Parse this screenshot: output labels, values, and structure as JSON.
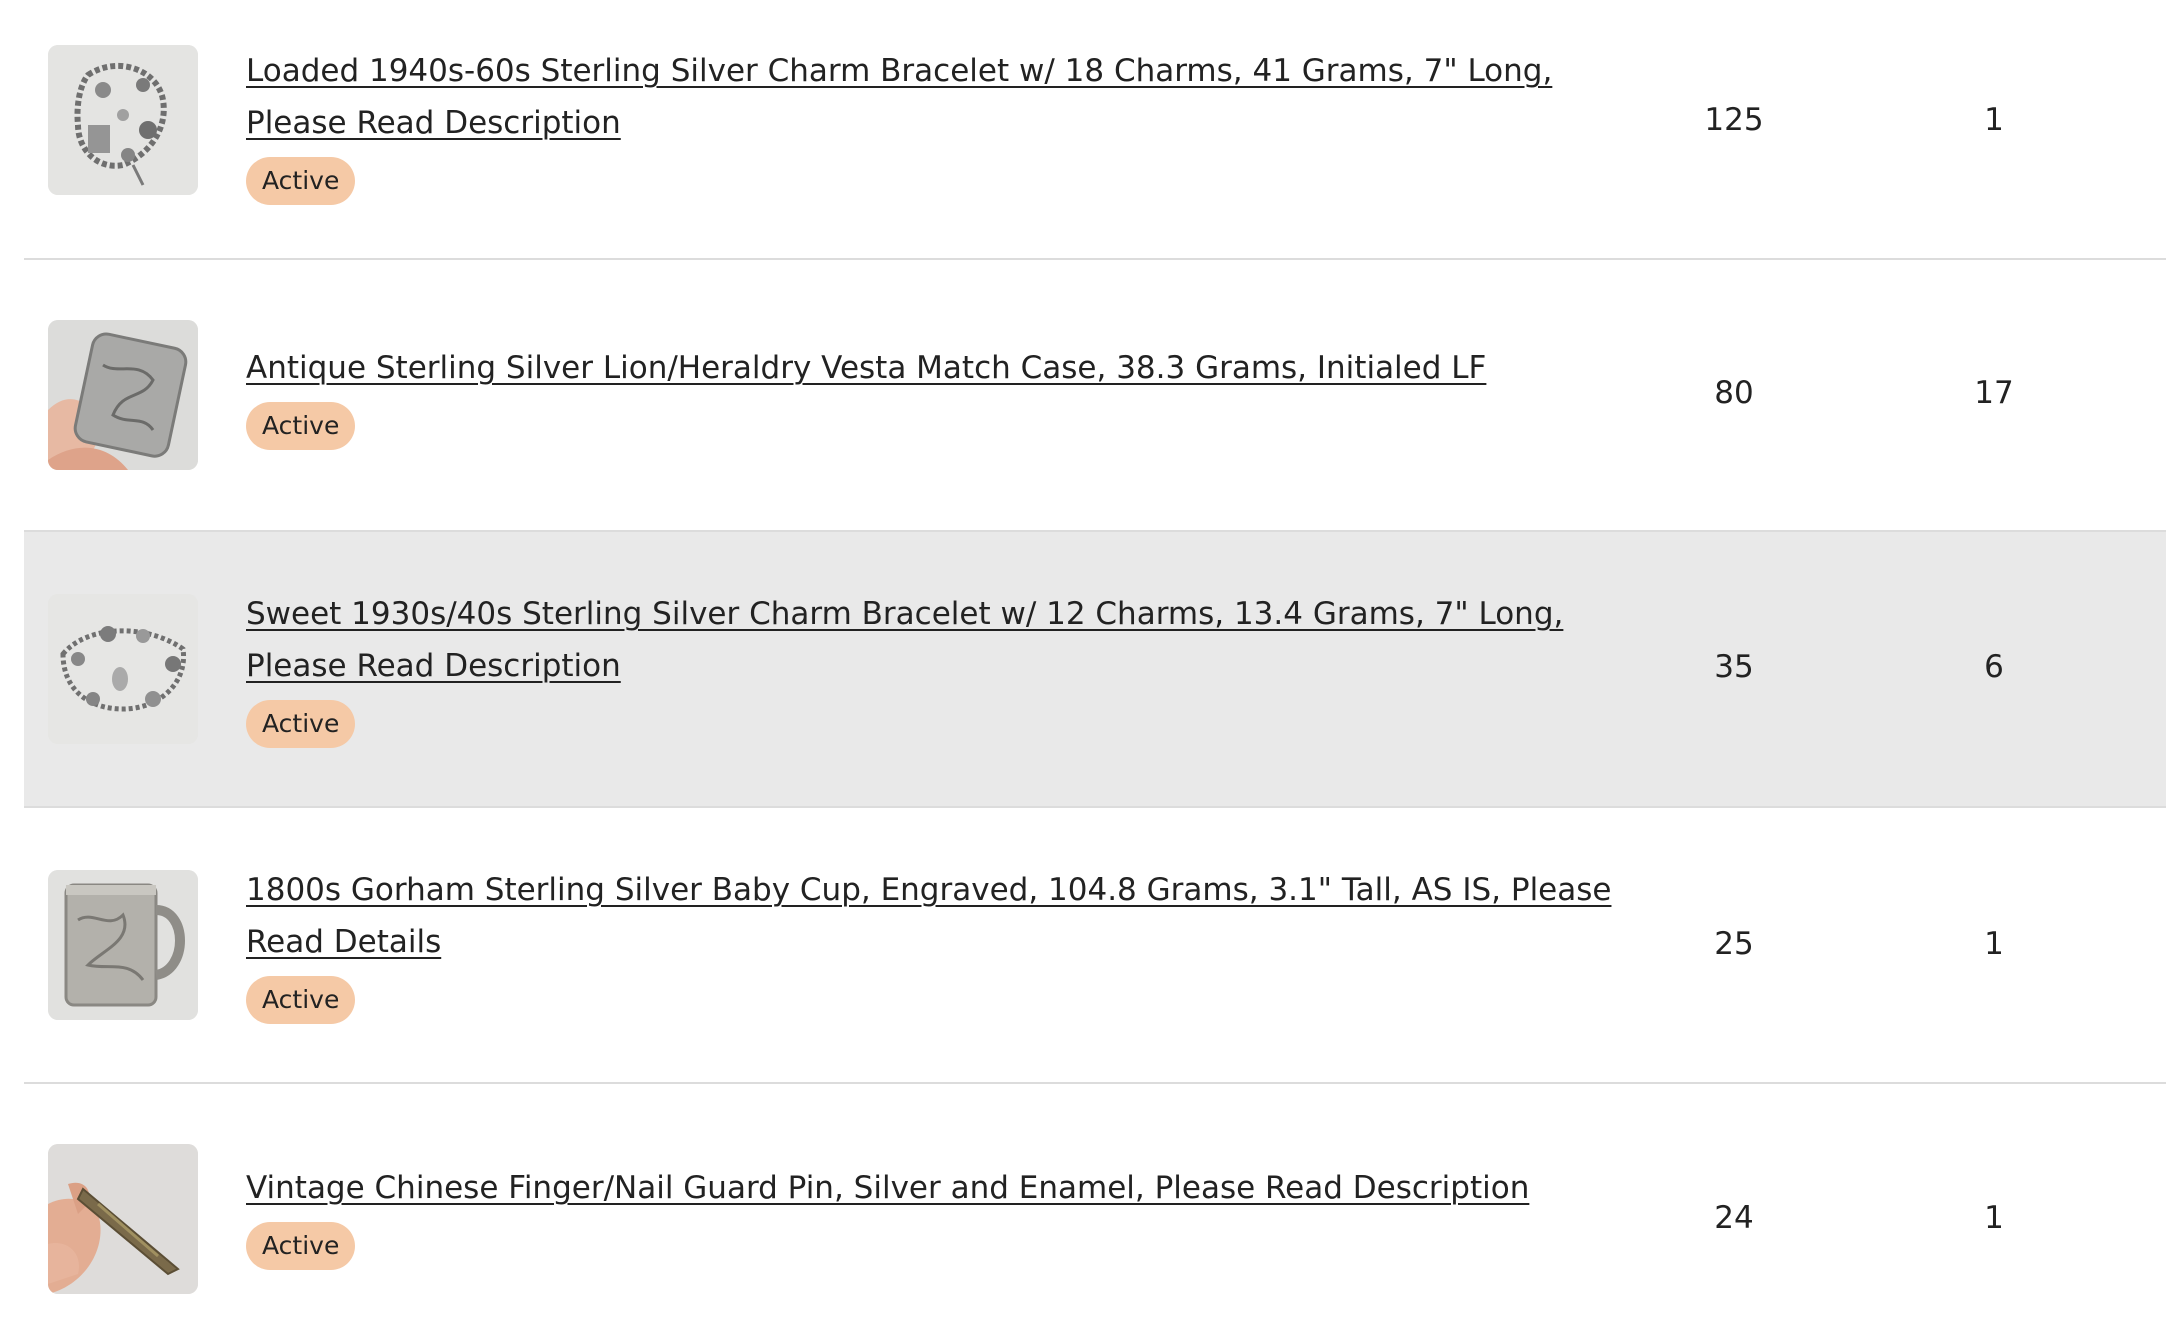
{
  "listings": [
    {
      "title": "Loaded 1940s-60s Sterling Silver Charm Bracelet w/ 18 Charms, 41 Grams, 7\" Long, Please Read Description",
      "status": "Active",
      "stat_a": "125",
      "stat_b": "1",
      "thumbnail": "charm-bracelet-thumbnail"
    },
    {
      "title": "Antique Sterling Silver Lion/Heraldry Vesta Match Case, 38.3 Grams, Initialed LF",
      "status": "Active",
      "stat_a": "80",
      "stat_b": "17",
      "thumbnail": "vesta-case-thumbnail"
    },
    {
      "title": "Sweet 1930s/40s Sterling Silver Charm Bracelet w/ 12 Charms, 13.4 Grams, 7\" Long, Please Read Description",
      "status": "Active",
      "stat_a": "35",
      "stat_b": "6",
      "thumbnail": "charm-bracelet-thumbnail"
    },
    {
      "title": "1800s Gorham Sterling Silver Baby Cup, Engraved, 104.8 Grams, 3.1\" Tall, AS IS, Please Read Details",
      "status": "Active",
      "stat_a": "25",
      "stat_b": "1",
      "thumbnail": "baby-cup-thumbnail"
    },
    {
      "title": "Vintage Chinese Finger/Nail Guard Pin, Silver and Enamel, Please Read Description",
      "status": "Active",
      "stat_a": "24",
      "stat_b": "1",
      "thumbnail": "nail-guard-pin-thumbnail"
    }
  ],
  "colors": {
    "badge_bg": "#f5c9a6",
    "row_highlight": "#e9e9e9",
    "divider": "#dcdcdc",
    "text": "#222222"
  }
}
